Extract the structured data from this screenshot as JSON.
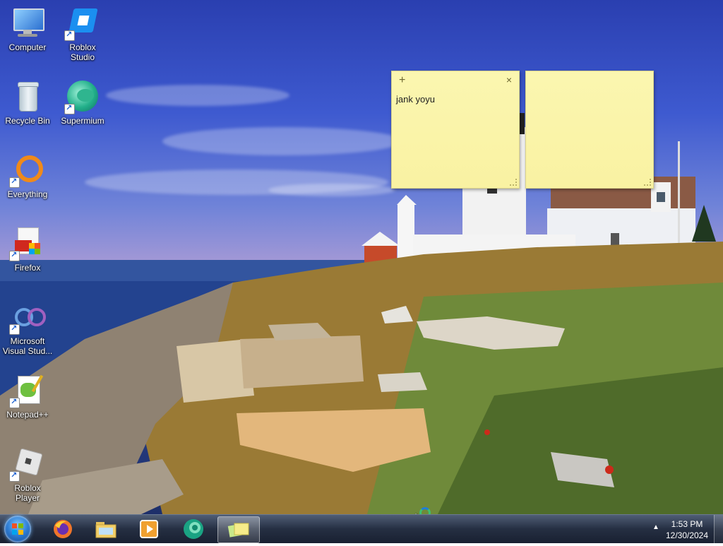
{
  "desktop": {
    "icons": [
      {
        "label": "Computer",
        "icon": "computer-icon"
      },
      {
        "label": "Roblox Studio",
        "icon": "roblox-studio-icon"
      },
      {
        "label": "Recycle Bin",
        "icon": "recycle-bin-icon"
      },
      {
        "label": "Supermium",
        "icon": "supermium-icon"
      },
      {
        "label": "Everything",
        "icon": "everything-icon"
      },
      {
        "label": "Firefox",
        "icon": "firefox-pdf-icon"
      },
      {
        "label": "Microsoft Visual Stud...",
        "icon": "visual-studio-icon"
      },
      {
        "label": "Notepad++",
        "icon": "notepadpp-icon"
      },
      {
        "label": "Roblox Player",
        "icon": "roblox-player-icon"
      }
    ]
  },
  "sticky_notes": [
    {
      "add_label": "+",
      "close_label": "×",
      "text": "jank yoyu"
    },
    {
      "add_label": "",
      "close_label": "",
      "text": ""
    }
  ],
  "taskbar": {
    "start": {
      "icon": "windows-start-icon"
    },
    "pinned": [
      {
        "icon": "firefox-icon"
      },
      {
        "icon": "file-explorer-icon"
      },
      {
        "icon": "media-player-icon"
      },
      {
        "icon": "supermium-icon"
      },
      {
        "icon": "sticky-notes-icon",
        "active": true
      }
    ],
    "tray_arrow": "▲",
    "clock": {
      "time": "1:53 PM",
      "date": "12/30/2024"
    }
  },
  "colors": {
    "sticky_bg": "#f9f2a2",
    "taskbar": "#1e2a40"
  }
}
